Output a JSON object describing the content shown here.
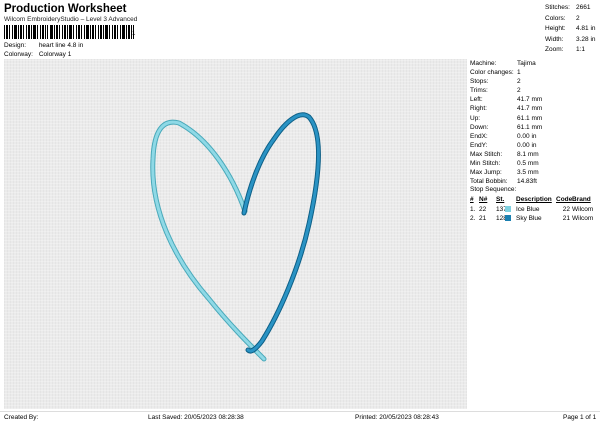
{
  "header": {
    "title": "Production Worksheet",
    "subtitle": "Wilcom EmbroideryStudio – Level 3 Advanced",
    "barcode_number": "1"
  },
  "design_info": {
    "design_label": "Design:",
    "design_value": "heart line 4.8 in",
    "colorway_label": "Colorway:",
    "colorway_value": "Colorway 1"
  },
  "top_stats": [
    {
      "label": "Stitches:",
      "value": "2661"
    },
    {
      "label": "Colors:",
      "value": "2"
    },
    {
      "label": "Height:",
      "value": "4.81 in"
    },
    {
      "label": "Width:",
      "value": "3.28 in"
    },
    {
      "label": "Zoom:",
      "value": "1:1"
    }
  ],
  "machine_stats": [
    {
      "label": "Machine:",
      "value": "Tajima"
    },
    {
      "label": "Color changes:",
      "value": "1"
    },
    {
      "label": "Stops:",
      "value": "2"
    },
    {
      "label": "Trims:",
      "value": "2"
    },
    {
      "label": "Left:",
      "value": "41.7 mm"
    },
    {
      "label": "Right:",
      "value": "41.7 mm"
    },
    {
      "label": "Up:",
      "value": "61.1 mm"
    },
    {
      "label": "Down:",
      "value": "61.1 mm"
    },
    {
      "label": "EndX:",
      "value": "0.00 in"
    },
    {
      "label": "EndY:",
      "value": "0.00 in"
    },
    {
      "label": "Max Stitch:",
      "value": "8.1 mm"
    },
    {
      "label": "Min Stitch:",
      "value": "0.5 mm"
    },
    {
      "label": "Max Jump:",
      "value": "3.5 mm"
    },
    {
      "label": "Total Bobbin:",
      "value": "14.83ft"
    }
  ],
  "stop_sequence": {
    "title": "Stop Sequence:",
    "headers": {
      "index": "#",
      "number": "N#",
      "st": "St.",
      "description": "Description",
      "code": "Code",
      "brand": "Brand"
    },
    "rows": [
      {
        "index": "1.",
        "number": "22",
        "st": "1377",
        "color": "#7fd0df",
        "description": "Ice Blue",
        "code": "22",
        "brand": "Wilcom"
      },
      {
        "index": "2.",
        "number": "21",
        "st": "1282",
        "color": "#1a7fb0",
        "description": "Sky Blue",
        "code": "21",
        "brand": "Wilcom"
      }
    ]
  },
  "colors": {
    "thread_light": "#7fd0df",
    "thread_light_edge": "#4aa9ba",
    "thread_dark": "#1f88b8",
    "thread_dark_edge": "#0d5f86",
    "canvas_bg": "#ebebeb"
  },
  "footer": {
    "created_by": "Created By:",
    "last_saved": "Last Saved: 20/05/2023 08:28:38",
    "printed": "Printed: 20/05/2023 08:28:43",
    "page": "Page 1 of 1"
  }
}
